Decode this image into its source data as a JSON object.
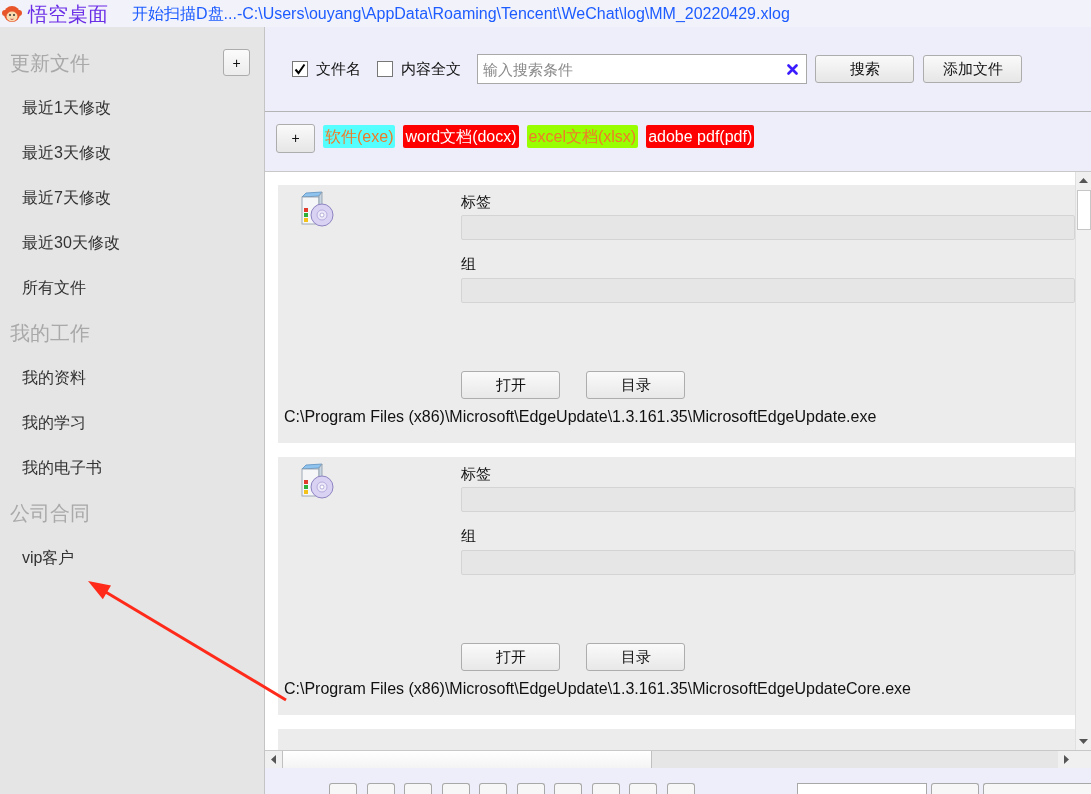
{
  "title_bar": {
    "app_name": "悟空桌面",
    "status_text": "开始扫描D盘...-C:\\Users\\ouyang\\AppData\\Roaming\\Tencent\\WeChat\\log\\MM_20220429.xlog"
  },
  "sidebar": {
    "sections": [
      {
        "title": "更新文件",
        "add_button": "+",
        "items": [
          "最近1天修改",
          "最近3天修改",
          "最近7天修改",
          "最近30天修改",
          "所有文件"
        ]
      },
      {
        "title": "我的工作",
        "items": [
          "我的资料",
          "我的学习",
          "我的电子书"
        ]
      },
      {
        "title": "公司合同",
        "items": [
          "vip客户"
        ]
      }
    ]
  },
  "search_bar": {
    "options": [
      {
        "label": "文件名",
        "checked": true
      },
      {
        "label": "内容全文",
        "checked": false
      }
    ],
    "search_field": {
      "placeholder": "输入搜索条件"
    },
    "buttons": [
      "搜索",
      "添加文件"
    ]
  },
  "tag_bar": {
    "add_button": "+",
    "tags": [
      {
        "label": "软件(exe)",
        "color": "#55ffff"
      },
      {
        "label": "word文档(docx)",
        "color": "#ff0000"
      },
      {
        "label": "excel文档(xlsx)",
        "color": "#99ff00"
      },
      {
        "label": "adobe pdf(pdf)",
        "color": "#ff0000"
      }
    ]
  },
  "file_list": {
    "files": [
      {
        "tag_label": "标签",
        "group_label": "组",
        "buttons": [
          "打开",
          "目录"
        ],
        "path": "C:\\Program Files (x86)\\Microsoft\\EdgeUpdate\\1.3.161.35\\MicrosoftEdgeUpdate.exe"
      },
      {
        "tag_label": "标签",
        "group_label": "组",
        "buttons": [
          "打开",
          "目录"
        ],
        "path": "C:\\Program Files (x86)\\Microsoft\\EdgeUpdate\\1.3.161.35\\MicrosoftEdgeUpdateCore.exe"
      }
    ],
    "more_below": true
  },
  "pagination": {
    "controls": [
      {
        "kind": "page"
      },
      {
        "kind": "page"
      },
      {
        "kind": "page"
      },
      {
        "kind": "page"
      },
      {
        "kind": "page"
      },
      {
        "kind": "page"
      },
      {
        "kind": "page"
      },
      {
        "kind": "page"
      },
      {
        "kind": "page"
      },
      {
        "kind": "page"
      },
      {
        "kind": "field"
      },
      {
        "kind": "button"
      },
      {
        "kind": "dropdown"
      }
    ]
  }
}
